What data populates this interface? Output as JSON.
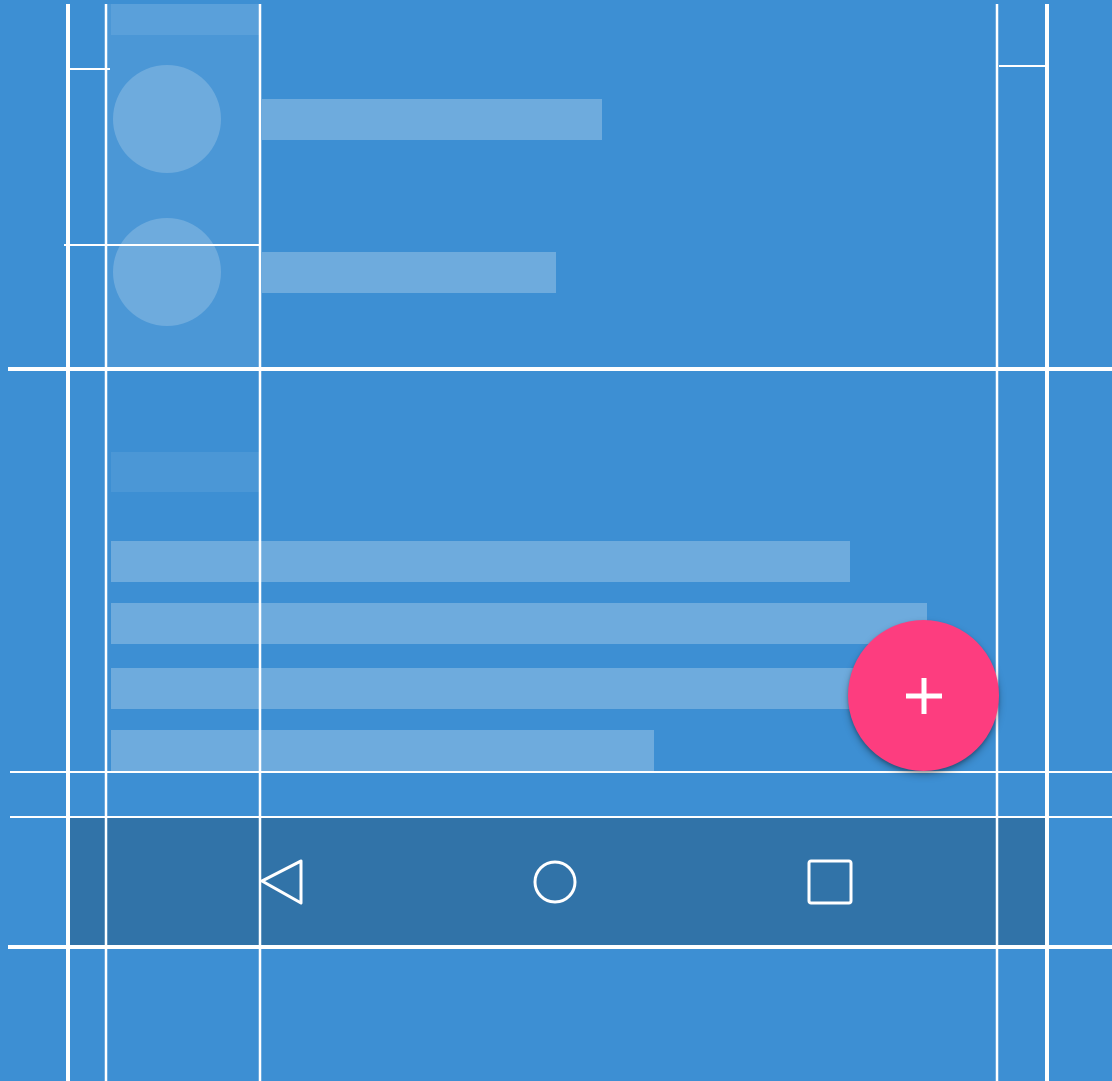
{
  "colors": {
    "background": "#3d8fd3",
    "guide_line": "#ffffff",
    "keyline_band": "#4b97d6",
    "placeholder": "#6eabdd",
    "nav_bar": "#3173a8",
    "fab": "#fd3d7f",
    "fab_icon": "#ffffff"
  },
  "icons": {
    "fab": "plus-icon",
    "back": "back-triangle-icon",
    "home": "home-circle-icon",
    "recents": "recents-square-icon"
  }
}
